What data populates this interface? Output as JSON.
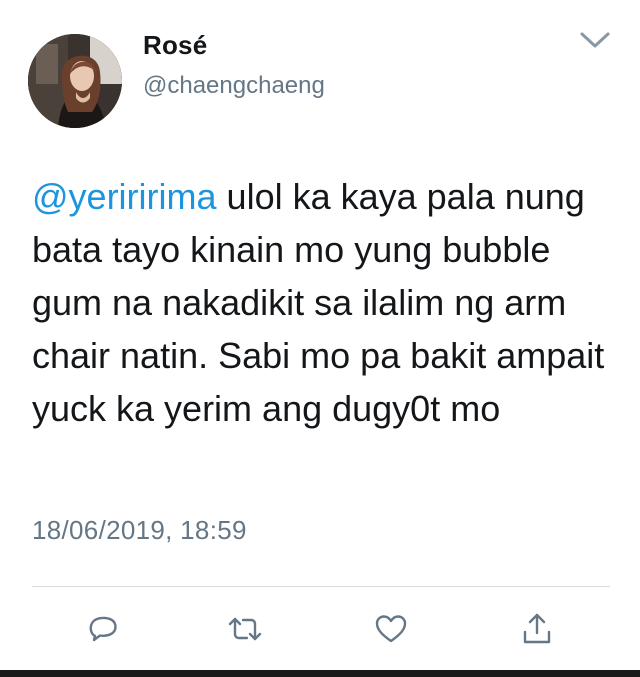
{
  "user": {
    "display_name": "Rosé",
    "handle": "@chaengchaeng"
  },
  "tweet": {
    "mention": "@yeriririma",
    "body": " ulol ka kaya pala nung bata tayo kinain mo yung bubble gum na nakadikit sa ilalim ng arm chair natin. Sabi mo pa bakit ampait yuck ka yerim ang dugy0t mo",
    "timestamp": "18/06/2019, 18:59"
  },
  "icons": {
    "caret": "chevron-down-icon",
    "reply": "reply-icon",
    "retweet": "retweet-icon",
    "like": "heart-icon",
    "share": "share-icon"
  },
  "colors": {
    "mention": "#1b95e0",
    "secondary_text": "#657786",
    "icon": "#657786"
  }
}
